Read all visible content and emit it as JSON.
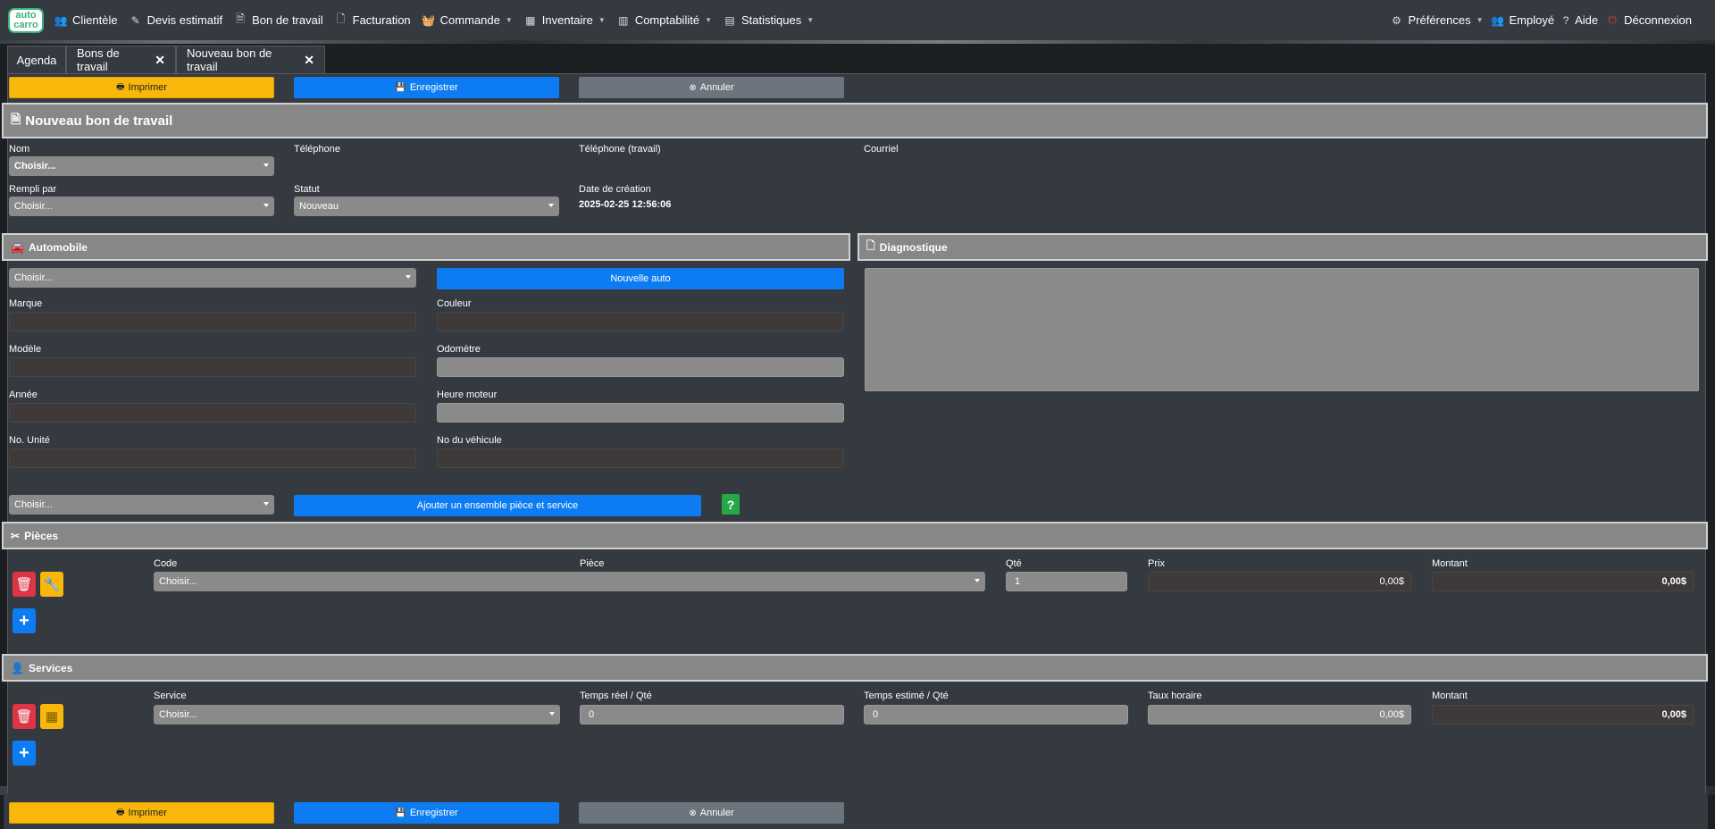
{
  "logo": {
    "line1": "auto",
    "line2": "carro"
  },
  "nav": {
    "items": [
      {
        "label": "Clientèle",
        "icon": "users-icon",
        "glyph": "👥",
        "caret": false
      },
      {
        "label": "Devis estimatif",
        "icon": "edit-icon",
        "glyph": "✎",
        "caret": false
      },
      {
        "label": "Bon de travail",
        "icon": "file-edit-icon",
        "glyph": "🗎",
        "caret": false
      },
      {
        "label": "Facturation",
        "icon": "file-icon",
        "glyph": "🗋",
        "caret": false
      },
      {
        "label": "Commande",
        "icon": "basket-icon",
        "glyph": "🧺",
        "caret": true
      },
      {
        "label": "Inventaire",
        "icon": "warehouse-icon",
        "glyph": "▦",
        "caret": true
      },
      {
        "label": "Comptabilité",
        "icon": "chart-bar-icon",
        "glyph": "▥",
        "caret": true
      },
      {
        "label": "Statistiques",
        "icon": "chart-area-icon",
        "glyph": "▤",
        "caret": true
      }
    ],
    "preferences": "Préférences",
    "employee": "Employé",
    "help": "Aide",
    "logout": "Déconnexion"
  },
  "tabs": [
    {
      "label": "Agenda",
      "closable": false
    },
    {
      "label": "Bons de travail",
      "closable": true
    },
    {
      "label": "Nouveau bon de travail",
      "closable": true
    }
  ],
  "actions": {
    "print": "Imprimer",
    "save": "Enregistrer",
    "cancel": "Annuler"
  },
  "page_title": "Nouveau bon de travail",
  "client": {
    "name_label": "Nom",
    "name_value": "Choisir...",
    "phone_label": "Téléphone",
    "work_phone_label": "Téléphone (travail)",
    "email_label": "Courriel",
    "filled_by_label": "Rempli par",
    "filled_by_value": "Choisir...",
    "status_label": "Statut",
    "status_value": "Nouveau",
    "created_label": "Date de création",
    "created_value": "2025-02-25 12:56:06"
  },
  "auto": {
    "title": "Automobile",
    "select_value": "Choisir...",
    "new_auto": "Nouvelle auto",
    "brand_label": "Marque",
    "color_label": "Couleur",
    "model_label": "Modèle",
    "odometer_label": "Odomètre",
    "year_label": "Année",
    "engine_hours_label": "Heure moteur",
    "unit_label": "No. Unité",
    "vehicle_no_label": "No du véhicule",
    "kit_select": "Choisir...",
    "add_kit": "Ajouter un ensemble pièce et service",
    "help": "?"
  },
  "diagnostic": {
    "title": "Diagnostique"
  },
  "parts": {
    "title": "Pièces",
    "headers": {
      "code": "Code",
      "part": "Pièce",
      "qty": "Qté",
      "price": "Prix",
      "amount": "Montant"
    },
    "row": {
      "select": "Choisir...",
      "qty": "1",
      "price": "0,00$",
      "amount": "0,00$"
    }
  },
  "services": {
    "title": "Services",
    "headers": {
      "service": "Service",
      "real_time": "Temps réel / Qté",
      "est_time": "Temps estimé / Qté",
      "rate": "Taux horaire",
      "amount": "Montant"
    },
    "row": {
      "select": "Choisir...",
      "real_time": "0",
      "est_time": "0",
      "rate": "0,00$",
      "amount": "0,00$"
    }
  }
}
